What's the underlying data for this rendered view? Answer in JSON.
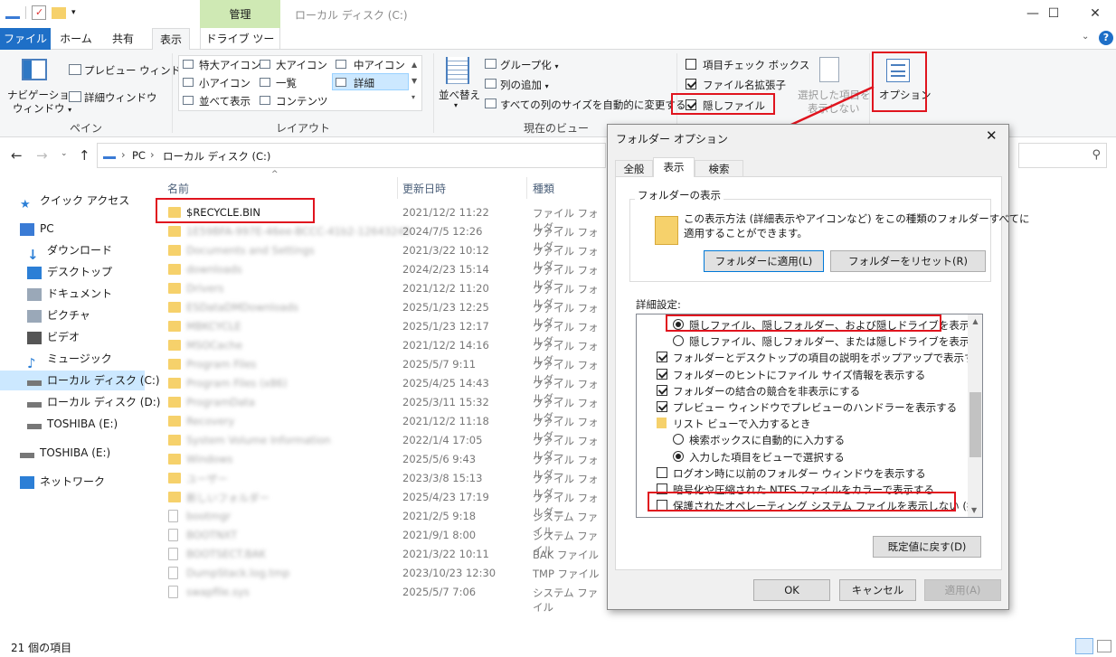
{
  "window": {
    "title": "ローカル ディスク (C:)",
    "manage_tab": "管理",
    "min": "—",
    "max": "☐",
    "close": "✕"
  },
  "tabs": {
    "file": "ファイル",
    "home": "ホーム",
    "share": "共有",
    "view": "表示",
    "drive_tools": "ドライブ ツール"
  },
  "ribbon": {
    "pane": {
      "nav_pane_line1": "ナビゲーション",
      "nav_pane_line2": "ウィンドウ",
      "preview": "プレビュー ウィンドウ",
      "details": "詳細ウィンドウ",
      "label": "ペイン"
    },
    "layout": {
      "xl_icons": "特大アイコン",
      "l_icons": "大アイコン",
      "m_icons": "中アイコン",
      "s_icons": "小アイコン",
      "list": "一覧",
      "details": "詳細",
      "tiles": "並べて表示",
      "content": "コンテンツ",
      "label": "レイアウト"
    },
    "current_view": {
      "sort": "並べ替え",
      "group": "グループ化",
      "add_column": "列の追加",
      "autosize": "すべての列のサイズを自動的に変更する",
      "label": "現在のビュー"
    },
    "show_hide": {
      "item_check": "項目チェック ボックス",
      "extensions": "ファイル名拡張子",
      "hidden": "隠しファイル",
      "hide_selected_line1": "選択した項目を",
      "hide_selected_line2": "表示しない"
    },
    "options": "オプション"
  },
  "address": {
    "pc": "PC",
    "drive": "ローカル ディスク (C:)",
    "sep": "›"
  },
  "nav": [
    {
      "label": "クイック アクセス",
      "icon": "star-icon"
    },
    {
      "label": "PC",
      "icon": "pc-icon"
    },
    {
      "label": "ダウンロード",
      "icon": "download-icon"
    },
    {
      "label": "デスクトップ",
      "icon": "desktop-icon"
    },
    {
      "label": "ドキュメント",
      "icon": "document-icon"
    },
    {
      "label": "ピクチャ",
      "icon": "picture-icon"
    },
    {
      "label": "ビデオ",
      "icon": "video-icon"
    },
    {
      "label": "ミュージック",
      "icon": "music-icon"
    },
    {
      "label": "ローカル ディスク (C:)",
      "icon": "drive-icon"
    },
    {
      "label": "ローカル ディスク (D:)",
      "icon": "drive-icon"
    },
    {
      "label": "TOSHIBA (E:)",
      "icon": "drive-icon"
    },
    {
      "label": "TOSHIBA (E:)",
      "icon": "drive-icon"
    },
    {
      "label": "ネットワーク",
      "icon": "network-icon"
    }
  ],
  "columns": {
    "name": "名前",
    "date": "更新日時",
    "type": "種類"
  },
  "files": [
    {
      "name": "$RECYCLE.BIN",
      "date": "2021/12/2 11:22",
      "type": "ファイル フォルダー",
      "kind": "folder"
    },
    {
      "name": "1E59BFA-997E-46ee-BCCC-41b2-12643245",
      "date": "2024/7/5 12:26",
      "type": "ファイル フォルダー",
      "kind": "folder"
    },
    {
      "name": "Documents and Settings",
      "date": "2021/3/22 10:12",
      "type": "ファイル フォルダー",
      "kind": "link"
    },
    {
      "name": "downloads",
      "date": "2024/2/23 15:14",
      "type": "ファイル フォルダー",
      "kind": "folder"
    },
    {
      "name": "Drivers",
      "date": "2021/12/2 11:20",
      "type": "ファイル フォルダー",
      "kind": "folder"
    },
    {
      "name": "ESDataDMDownloads",
      "date": "2025/1/23 12:25",
      "type": "ファイル フォルダー",
      "kind": "folder"
    },
    {
      "name": "MBKCYCLE",
      "date": "2025/1/23 12:17",
      "type": "ファイル フォルダー",
      "kind": "folder"
    },
    {
      "name": "MSOCache",
      "date": "2021/12/2 14:16",
      "type": "ファイル フォルダー",
      "kind": "folder"
    },
    {
      "name": "Program Files",
      "date": "2025/5/7 9:11",
      "type": "ファイル フォルダー",
      "kind": "folder"
    },
    {
      "name": "Program Files (x86)",
      "date": "2025/4/25 14:43",
      "type": "ファイル フォルダー",
      "kind": "folder"
    },
    {
      "name": "ProgramData",
      "date": "2025/3/11 15:32",
      "type": "ファイル フォルダー",
      "kind": "folder"
    },
    {
      "name": "Recovery",
      "date": "2021/12/2 11:18",
      "type": "ファイル フォルダー",
      "kind": "folder"
    },
    {
      "name": "System Volume Information",
      "date": "2022/1/4 17:05",
      "type": "ファイル フォルダー",
      "kind": "folder"
    },
    {
      "name": "Windows",
      "date": "2025/5/6 9:43",
      "type": "ファイル フォルダー",
      "kind": "folder"
    },
    {
      "name": "ユーザー",
      "date": "2023/3/8 15:13",
      "type": "ファイル フォルダー",
      "kind": "folder"
    },
    {
      "name": "新しいフォルダー",
      "date": "2025/4/23 17:19",
      "type": "ファイル フォルダー",
      "kind": "folder"
    },
    {
      "name": "bootmgr",
      "date": "2021/2/5 9:18",
      "type": "システム ファイル",
      "kind": "sys"
    },
    {
      "name": "BOOTNXT",
      "date": "2021/9/1 8:00",
      "type": "システム ファイル",
      "kind": "sys"
    },
    {
      "name": "BOOTSECT.BAK",
      "date": "2021/3/22 10:11",
      "type": "BAK ファイル",
      "kind": "file"
    },
    {
      "name": "DumpStack.log.tmp",
      "date": "2023/10/23 12:30",
      "type": "TMP ファイル",
      "kind": "sys"
    },
    {
      "name": "swapfile.sys",
      "date": "2025/5/7 7:06",
      "type": "システム ファイル",
      "kind": "sys"
    }
  ],
  "status": "21 個の項目",
  "dialog": {
    "title": "フォルダー オプション",
    "tabs": [
      "全般",
      "表示",
      "検索"
    ],
    "folder_view_title": "フォルダーの表示",
    "folder_view_desc_1": "この表示方法 (詳細表示やアイコンなど) をこの種類のフォルダーすべてに",
    "folder_view_desc_2": "適用することができます。",
    "apply_btn": "フォルダーに適用(L)",
    "reset_btn": "フォルダーをリセット(R)",
    "advanced": "詳細設定:",
    "items": [
      {
        "kind": "radio",
        "checked": true,
        "indent": 1,
        "label": "隠しファイル、隠しフォルダー、および隠しドライブを表示する"
      },
      {
        "kind": "radio",
        "checked": false,
        "indent": 1,
        "label": "隠しファイル、隠しフォルダー、または隠しドライブを表示しない"
      },
      {
        "kind": "check",
        "checked": true,
        "indent": 0,
        "label": "フォルダーとデスクトップの項目の説明をポップアップで表示する"
      },
      {
        "kind": "check",
        "checked": true,
        "indent": 0,
        "label": "フォルダーのヒントにファイル サイズ情報を表示する"
      },
      {
        "kind": "check",
        "checked": true,
        "indent": 0,
        "label": "フォルダーの結合の競合を非表示にする"
      },
      {
        "kind": "check",
        "checked": true,
        "indent": 0,
        "label": "プレビュー ウィンドウでプレビューのハンドラーを表示する"
      },
      {
        "kind": "folder",
        "checked": false,
        "indent": 0,
        "label": "リスト ビューで入力するとき"
      },
      {
        "kind": "radio",
        "checked": false,
        "indent": 1,
        "label": "検索ボックスに自動的に入力する"
      },
      {
        "kind": "radio",
        "checked": true,
        "indent": 1,
        "label": "入力した項目をビューで選択する"
      },
      {
        "kind": "check",
        "checked": false,
        "indent": 0,
        "label": "ログオン時に以前のフォルダー ウィンドウを表示する"
      },
      {
        "kind": "check",
        "checked": false,
        "indent": 0,
        "label": "暗号化や圧縮された NTFS ファイルをカラーで表示する"
      },
      {
        "kind": "check",
        "checked": false,
        "indent": 0,
        "label": "保護されたオペレーティング システム ファイルを表示しない (推奨)"
      }
    ],
    "default_btn": "既定値に戻す(D)",
    "ok": "OK",
    "cancel": "キャンセル",
    "apply": "適用(A)",
    "close": "✕"
  },
  "colors": {
    "accent": "#1e6fc7",
    "highlight": "#e0141e",
    "manage": "#cfe9b4",
    "selected_nav": "#cce8ff"
  }
}
